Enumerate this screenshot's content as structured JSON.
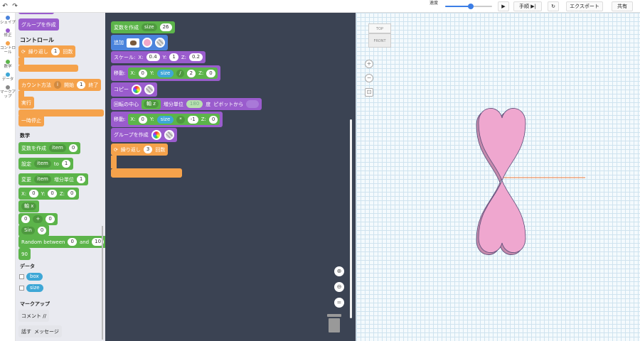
{
  "topbar": {
    "speed_label": "速度",
    "speed_value": 0.55,
    "step_label": "手順",
    "export_label": "エクスポート",
    "share_label": "共有"
  },
  "categories": [
    "シェイプ",
    "修正",
    "コントロール",
    "数学",
    "データ",
    "マークアップ"
  ],
  "flyout": {
    "group_block": "グループを作成",
    "control_title": "コントロール",
    "repeat_label": "繰り返し",
    "repeat_count": "1",
    "repeat_unit": "回数",
    "count_with": "カウント方法",
    "count_var": "i",
    "count_start": "開始",
    "count_start_val": "1",
    "count_end": "終了",
    "exec_label": "実行",
    "pause_label": "一時停止",
    "math_title": "数学",
    "create_var": "変数を作成",
    "var_item": "item",
    "var_item_val": "0",
    "set_label": "設定",
    "set_to": "to",
    "set_val": "1",
    "change_label": "変更",
    "change_step": "増分単位",
    "change_val": "1",
    "xyz_x": "X:",
    "xyz_x_val": "0",
    "xyz_y": "Y:",
    "xyz_y_val": "0",
    "xyz_z": "Z:",
    "xyz_z_val": "0",
    "axis_label": "軸 x",
    "op_left": "0",
    "op_sym": "+",
    "op_right": "0",
    "sin_label": "Sin",
    "sin_val": "0",
    "random_label": "Random between",
    "random_from": "0",
    "random_and": "and",
    "random_to": "10",
    "num_90": "90",
    "data_title": "データ",
    "data_box": "box",
    "data_size": "size",
    "markup_title": "マークアップ",
    "comment_label": "コメント //",
    "say_label": "話す",
    "say_msg": "メッセージ"
  },
  "workspace": {
    "var_create": "変数を作成",
    "var_name": "size",
    "var_value": "26",
    "add_label": "追加",
    "scale_label": "スケール:",
    "scale_x": "0.4",
    "scale_y": "1",
    "scale_z": "0.2",
    "move1_label": "移動:",
    "move1_x": "0",
    "move1_y_var": "size",
    "move1_op": "/",
    "move1_y_div": "2",
    "move1_z": "0",
    "copy_label": "コピー",
    "rotate_label": "回転の中心",
    "rotate_axis": "軸 z",
    "rotate_step": "増分単位",
    "rotate_val": "180",
    "rotate_unit": "度",
    "rotate_pivot": "ピボットから",
    "move2_label": "移動:",
    "move2_x": "0",
    "move2_y_var": "size",
    "move2_op": "*",
    "move2_y_mul": "-1",
    "move2_z": "0",
    "group_label": "グループを作成",
    "repeat_label": "繰り返し",
    "repeat_count": "3",
    "repeat_unit": "回数"
  },
  "viewport": {
    "cube_top": "TOP",
    "cube_front": "FRONT",
    "shape_color": "#efa7cf",
    "shape_edge": "#5a4d78"
  },
  "colors": {
    "control": "#f5a24b",
    "math": "#5cb44a",
    "modify": "#9a5ccd",
    "shapes": "#4a83dc",
    "data": "#3ea7d6",
    "workspace_bg": "#3b4353"
  }
}
